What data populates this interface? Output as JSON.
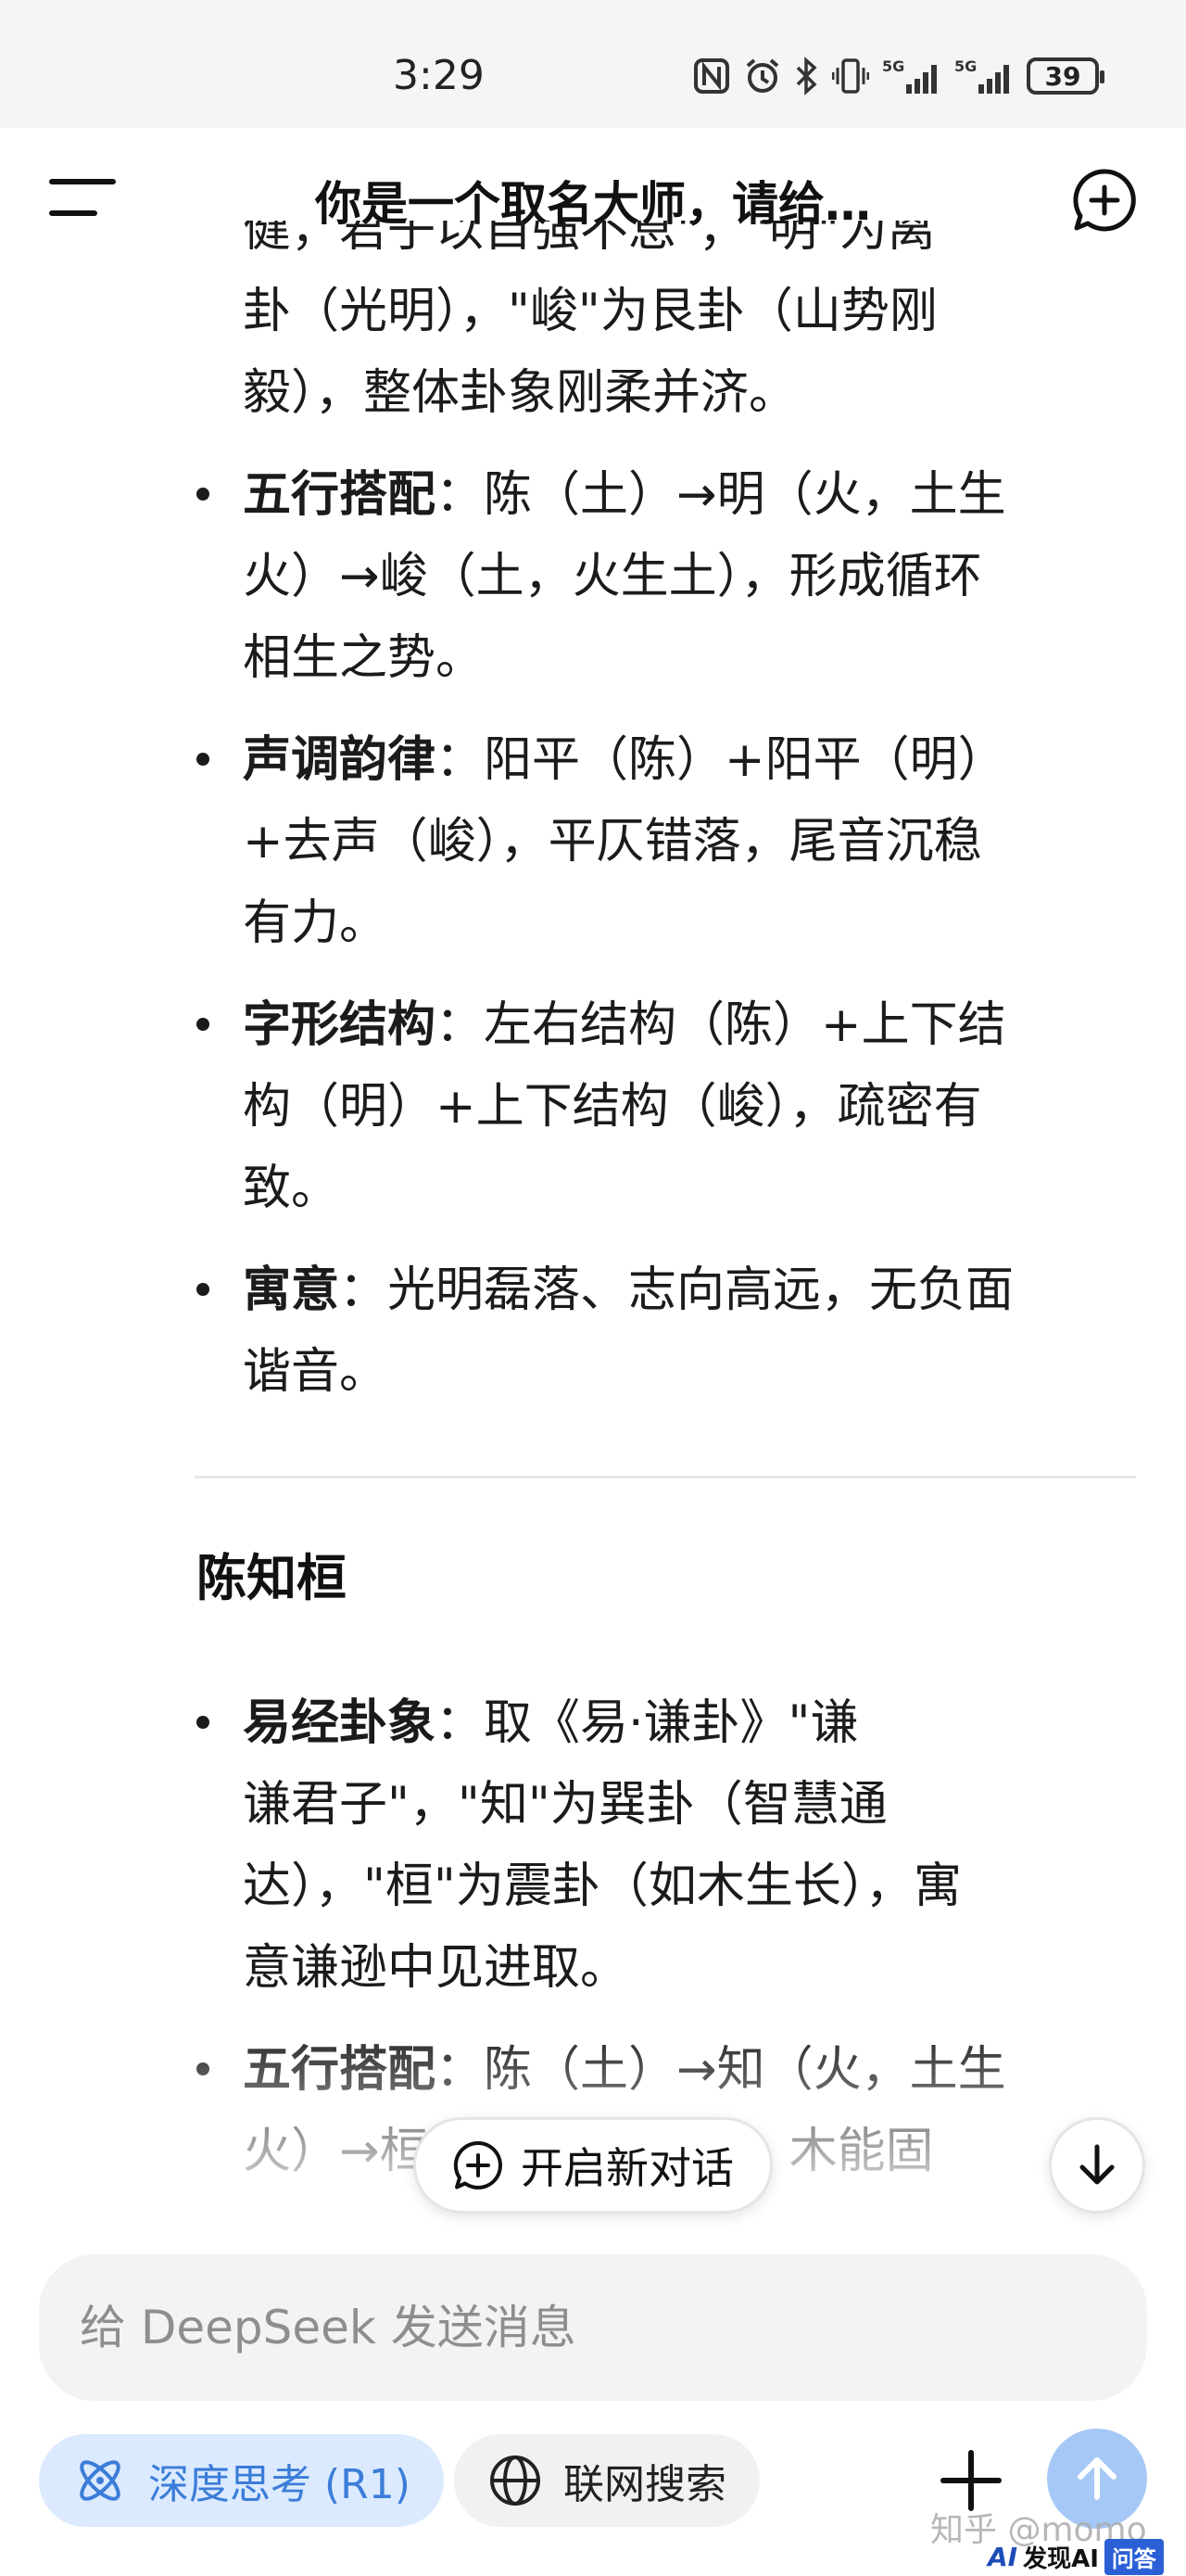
{
  "status_bar": {
    "time": "3:29",
    "battery": "39",
    "icons": [
      "nfc-icon",
      "alarm-icon",
      "bluetooth-icon",
      "vibrate-icon",
      "signal-5g-icon",
      "signal-5g-icon",
      "battery-icon"
    ]
  },
  "header": {
    "title": "你是一个取名大师，请给…"
  },
  "content": {
    "intro_lines": [
      "健，君子以自强不息\"，\"明\"为离",
      "卦（光明），\"峻\"为艮卦（山势刚",
      "毅），整体卦象刚柔并济。"
    ],
    "section1_bullets": [
      {
        "label": "五行搭配",
        "lines": [
          "：陈（土）→明（火，土生",
          "火）→峻（土，火生土），形成循环",
          "相生之势。"
        ]
      },
      {
        "label": "声调韵律",
        "lines": [
          "：阳平（陈）+阳平（明）",
          "+去声（峻），平仄错落，尾音沉稳",
          "有力。"
        ]
      },
      {
        "label": "字形结构",
        "lines": [
          "：左右结构（陈）+上下结",
          "构（明）+上下结构（峻），疏密有",
          "致。"
        ]
      },
      {
        "label": "寓意",
        "lines": [
          "：光明磊落、志向高远，无负面",
          "谐音。"
        ]
      }
    ],
    "section2_title": "陈知桓",
    "section2_bullets": [
      {
        "label": "易经卦象",
        "lines": [
          "：取《易·谦卦》\"谦",
          "谦君子\"，\"知\"为巽卦（智慧通",
          "达），\"桓\"为震卦（如木生长），寓",
          "意谦逊中见进取。"
        ]
      },
      {
        "label": "五行搭配",
        "lines": [
          "：陈（土）→知（火，土生",
          "火）→桓（木，火生木），木能固"
        ]
      }
    ]
  },
  "floating": {
    "new_chat_label": "开启新对话"
  },
  "input": {
    "placeholder": "给 DeepSeek 发送消息"
  },
  "toolbar": {
    "deep_think_label": "深度思考 (R1)",
    "web_search_label": "联网搜索"
  },
  "overlay": {
    "watermark": "知乎 @momo",
    "badge_ai": "AI",
    "badge_text": "发现AI",
    "badge_box": "问答"
  },
  "colors": {
    "accent": "#3b7dd8",
    "chip_active_bg": "#dbeafe",
    "send_button": "#a6c8f6",
    "input_bg": "#f3f3f4"
  }
}
